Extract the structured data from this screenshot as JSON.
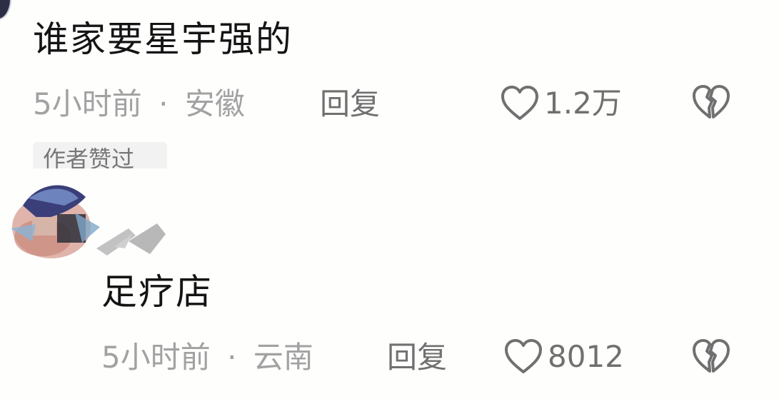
{
  "comments": [
    {
      "text": "谁家要星宇强的",
      "time": "5小时前",
      "separator": "·",
      "location": "安徽",
      "reply_label": "回复",
      "like_count": "1.2万",
      "badge": "作者赞过"
    },
    {
      "text": "足疗店",
      "time": "5小时前",
      "separator": "·",
      "location": "云南",
      "reply_label": "回复",
      "like_count": "8012"
    }
  ],
  "icons": {
    "like": "heart-outline-icon",
    "dislike": "broken-heart-icon"
  },
  "colors": {
    "background": "#fefefd",
    "text_primary": "#141414",
    "text_meta": "#a2a2a2",
    "text_action": "#707070",
    "badge_bg": "#f2f2f2"
  }
}
